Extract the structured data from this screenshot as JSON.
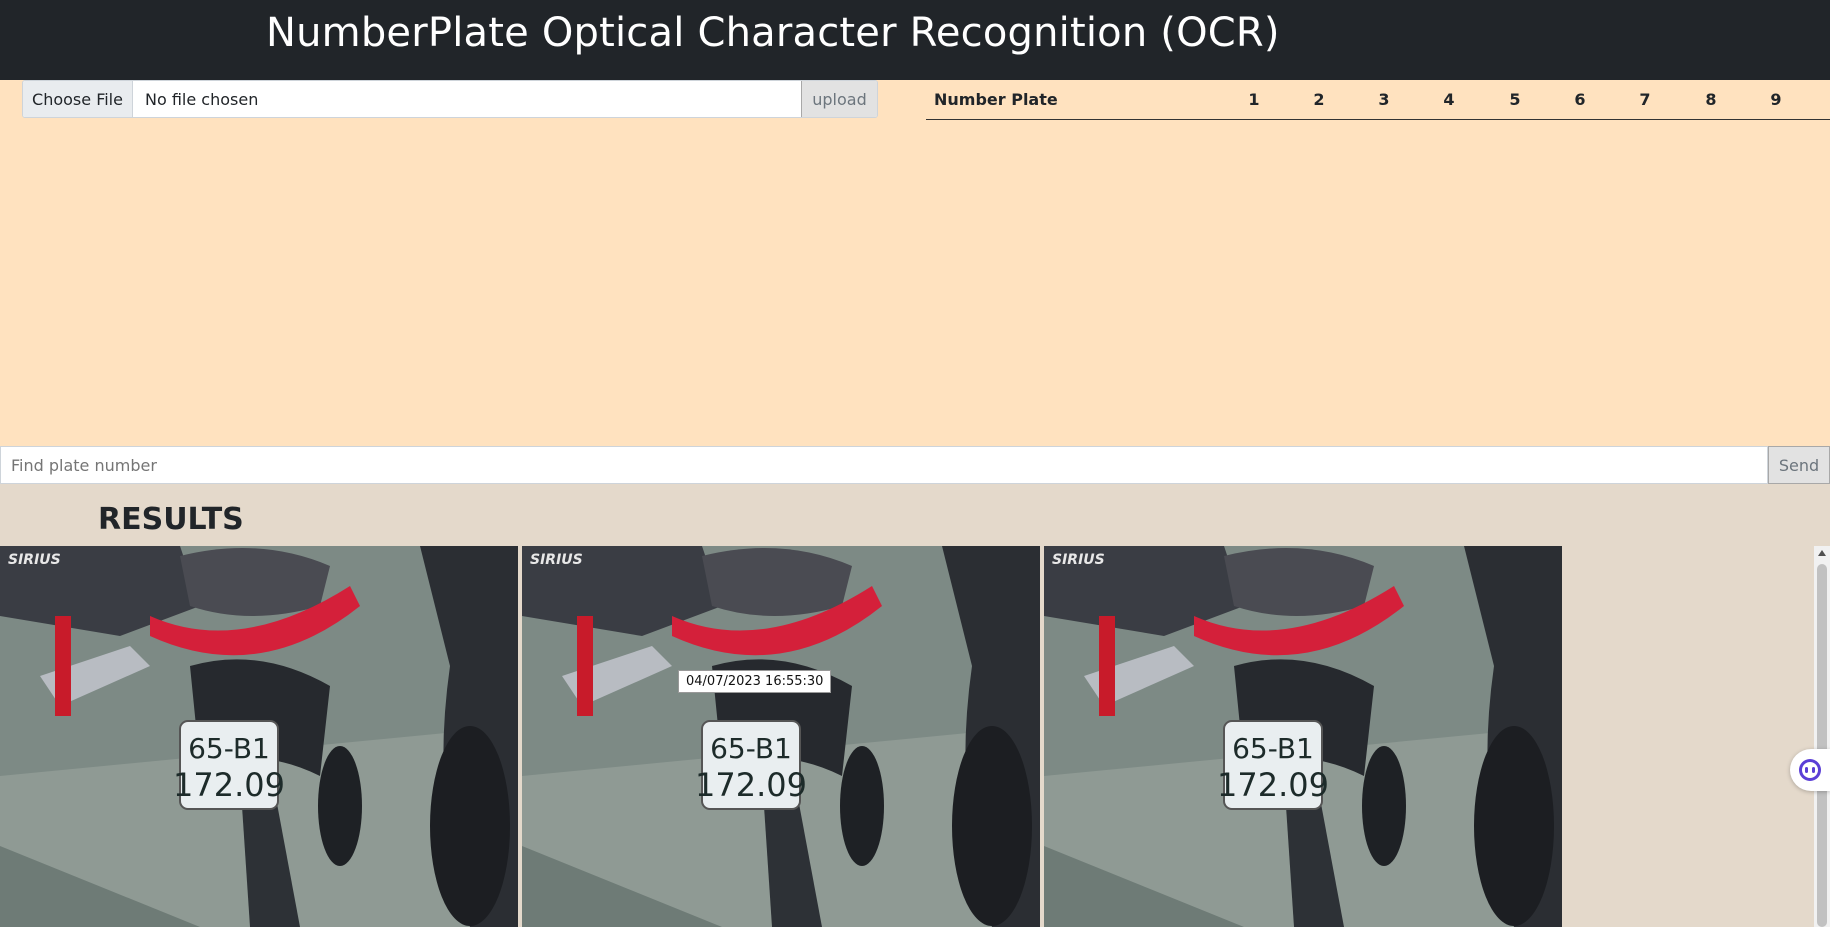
{
  "header": {
    "title": "NumberPlate Optical Character Recognition (OCR)"
  },
  "upload": {
    "choose_label": "Choose File",
    "file_status": "No file chosen",
    "upload_label": "upload"
  },
  "plate_table": {
    "columns": [
      "Number Plate",
      "1",
      "2",
      "3",
      "4",
      "5",
      "6",
      "7",
      "8",
      "9"
    ]
  },
  "search": {
    "placeholder": "Find plate number",
    "send_label": "Send"
  },
  "results": {
    "title": "RESULTS",
    "items": [
      {
        "plate_line1": "65-B1",
        "plate_line2": "172.09",
        "brand": "SIRIUS"
      },
      {
        "plate_line1": "65-B1",
        "plate_line2": "172.09",
        "brand": "SIRIUS",
        "timestamp": "04/07/2023 16:55:30"
      },
      {
        "plate_line1": "65-B1",
        "plate_line2": "172.09",
        "brand": "SIRIUS"
      }
    ]
  },
  "colors": {
    "header_bg": "#212529",
    "upload_area_bg": "#ffe2bf",
    "page_bg": "#e4d9cb"
  },
  "icons": {
    "assistant": "assistant-face-icon"
  }
}
